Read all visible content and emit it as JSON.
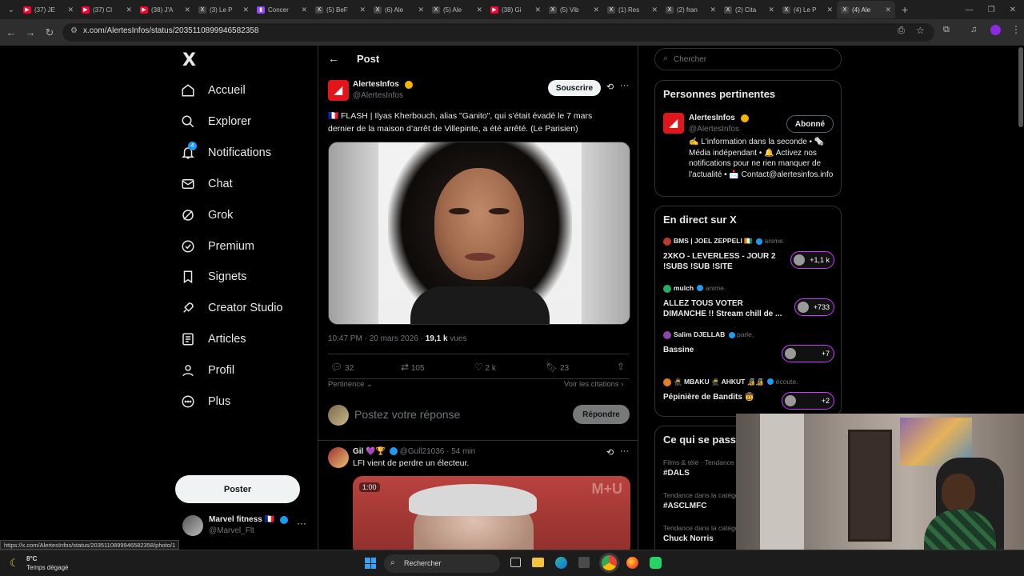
{
  "browser": {
    "tabs": [
      {
        "label": "(37) JE",
        "color": "#ff0033",
        "glyph": "▶"
      },
      {
        "label": "(37) Cl",
        "color": "#ff0033",
        "glyph": "▶"
      },
      {
        "label": "(38) J'A",
        "color": "#ff0033",
        "glyph": "▶"
      },
      {
        "label": "(3) Le P",
        "color": "#444444",
        "glyph": "X"
      },
      {
        "label": "Concer",
        "color": "#9146ff",
        "glyph": "▮"
      },
      {
        "label": "(5) BeF",
        "color": "#444444",
        "glyph": "X"
      },
      {
        "label": "(6) Ale",
        "color": "#444444",
        "glyph": "X"
      },
      {
        "label": "(5) Ale",
        "color": "#444444",
        "glyph": "X"
      },
      {
        "label": "(38) Gi",
        "color": "#ff0033",
        "glyph": "▶"
      },
      {
        "label": "(5) Vib",
        "color": "#444444",
        "glyph": "X"
      },
      {
        "label": "(1) Res",
        "color": "#444444",
        "glyph": "X"
      },
      {
        "label": "(2) fran",
        "color": "#444444",
        "glyph": "X"
      },
      {
        "label": "(2) Cita",
        "color": "#444444",
        "glyph": "X"
      },
      {
        "label": "(4) Le P",
        "color": "#444444",
        "glyph": "X"
      },
      {
        "label": "(4) Ale",
        "color": "#444444",
        "glyph": "X"
      }
    ],
    "url": "x.com/AlertesInfos/status/2035110899946582358",
    "status_url": "https://x.com/AlertesInfos/status/2035110899946582358/photo/1"
  },
  "sidebar": {
    "logo": "X",
    "items": [
      {
        "label": "Accueil",
        "icon": "home-icon"
      },
      {
        "label": "Explorer",
        "icon": "search-icon"
      },
      {
        "label": "Notifications",
        "icon": "bell-icon",
        "badge": "4"
      },
      {
        "label": "Chat",
        "icon": "mail-icon"
      },
      {
        "label": "Grok",
        "icon": "grok-icon"
      },
      {
        "label": "Premium",
        "icon": "premium-icon"
      },
      {
        "label": "Signets",
        "icon": "bookmark-icon"
      },
      {
        "label": "Creator Studio",
        "icon": "rocket-icon"
      },
      {
        "label": "Articles",
        "icon": "article-icon"
      },
      {
        "label": "Profil",
        "icon": "person-icon"
      },
      {
        "label": "Plus",
        "icon": "more-circle-icon"
      }
    ],
    "post_button": "Poster",
    "account": {
      "name": "Marvel fitness 🇫🇷",
      "handle": "@Marvel_Flt"
    }
  },
  "post": {
    "header": "Post",
    "author": {
      "name": "AlertesInfos",
      "handle": "@AlertesInfos"
    },
    "subscribe": "Souscrire",
    "text": "🇫🇷 FLASH | Ilyas Kherbouch, alias \"Ganito\", qui s’était évadé le 7 mars dernier de la maison d’arrêt de Villepinte, a été arrêté. (Le Parisien)",
    "timestamp": "10:47 PM · 20 mars 2026 · ",
    "views_count": "19,1 k",
    "views_label": " vues",
    "stats": {
      "replies": "32",
      "reposts": "105",
      "likes": "2 k",
      "bookmarks": "23"
    },
    "sort": "Pertinence",
    "citations": "Voir les citations",
    "reply_placeholder": "Postez votre réponse",
    "reply_button": "Répondre"
  },
  "reply": {
    "name": "Gil 💜🏆",
    "handle": "@Gull21036 · 54 min",
    "text": "LFI vient de perdre un électeur.",
    "video_time": "1:00",
    "video_overlay": "M+U"
  },
  "right": {
    "search_placeholder": "Chercher",
    "relevant": {
      "title": "Personnes pertinentes",
      "name": "AlertesInfos",
      "handle": "@AlertesInfos",
      "follow": "Abonné",
      "bio": "✍️ L'information dans la seconde • 🗞️ Média indépendant • 🔔 Activez nos notifications pour ne rien manquer de l'actualité • 📩 Contact@alertesinfos.info"
    },
    "live": {
      "title": "En direct sur X",
      "items": [
        {
          "host": "BMS | JOEL ZEPPELI 🇨🇮",
          "action": "anime.",
          "title": "2XKO - LEVERLESS - JOUR 2 !SUBS !SUB !SITE",
          "count": "+1,1 k"
        },
        {
          "host": "mulch",
          "action": "anime.",
          "title": "ALLEZ TOUS VOTER DIMANCHE !! Stream chill de ...",
          "count": "+733"
        },
        {
          "host": "Salim DJELLAB",
          "action": "parle.",
          "title": "Bassine",
          "count": "+7"
        },
        {
          "host": "🥷 MBAKU 🥷 AHKUT 🔏🔏",
          "action": "écoute.",
          "title": "Pépinière de Bandits 🤠",
          "count": "+2"
        }
      ]
    },
    "trends": {
      "title": "Ce qui se passe",
      "items": [
        {
          "context": "Films & télé · Tendance",
          "name": "#DALS"
        },
        {
          "context": "Tendance dans la catégorie",
          "name": "#ASCLMFC"
        },
        {
          "context": "Tendance dans la catégorie",
          "name": "Chuck Norris"
        }
      ]
    }
  },
  "taskbar": {
    "temp": "8°C",
    "weather": "Temps dégagé",
    "search": "Rechercher"
  }
}
